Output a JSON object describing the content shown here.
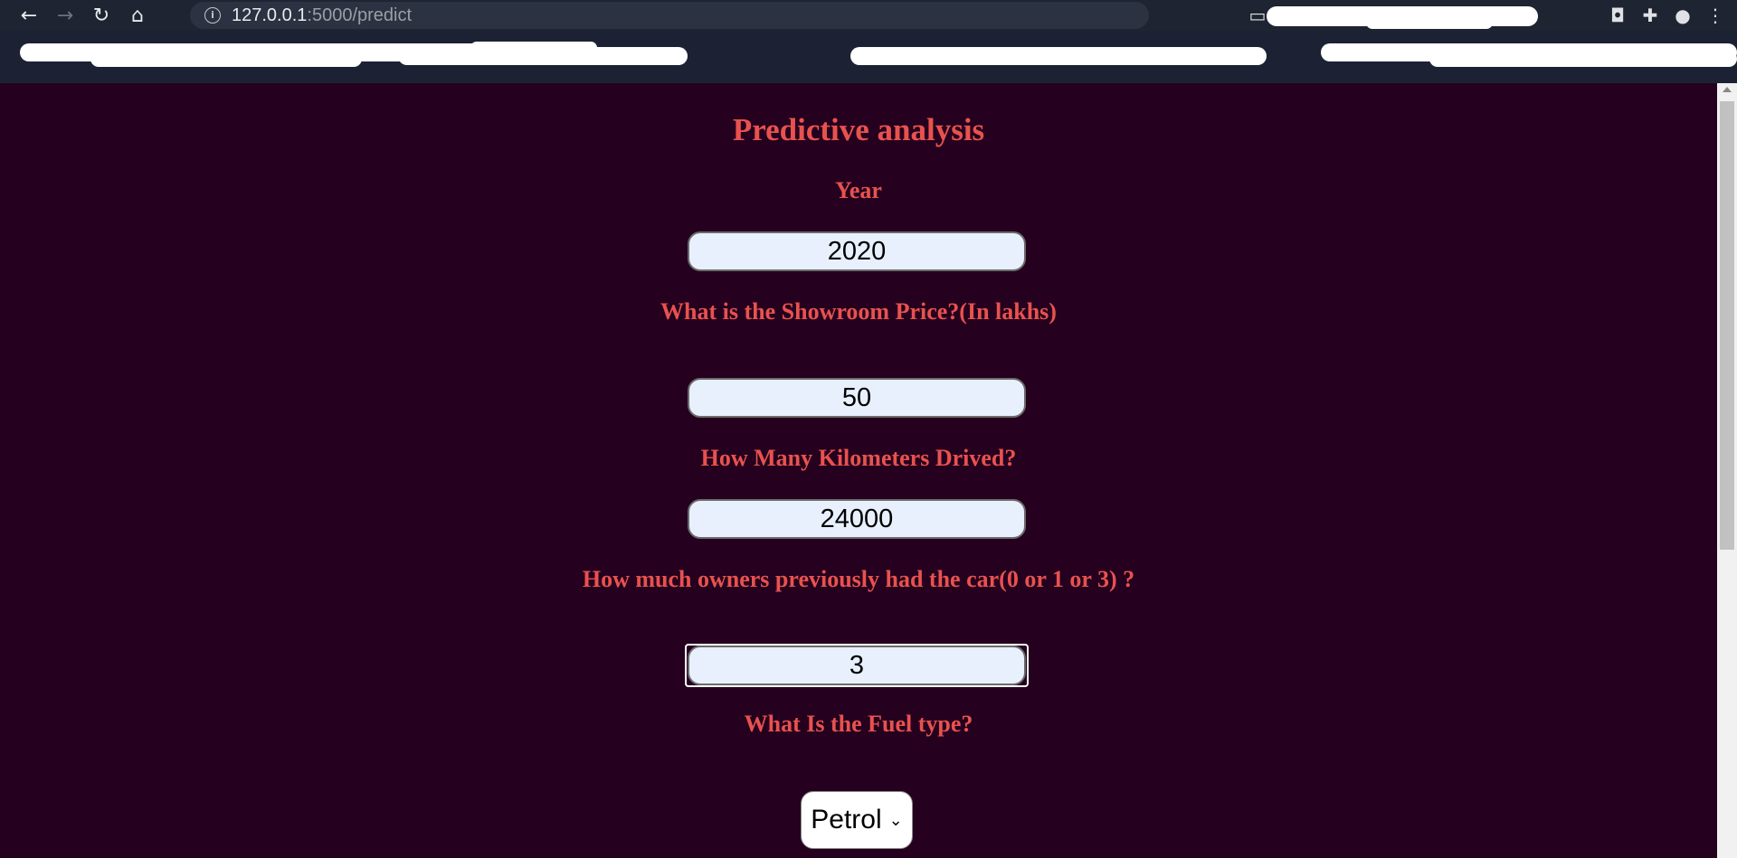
{
  "browser": {
    "url_host": "127.0.0.1",
    "url_path": ":5000/predict",
    "icons": [
      "back-arrow-icon",
      "forward-arrow-icon",
      "reload-icon",
      "home-icon",
      "info-icon",
      "cast-icon",
      "grid-icon",
      "star-icon",
      "extensions-puzzle-icon",
      "profile-avatar-icon",
      "menu-kebab-icon"
    ]
  },
  "page": {
    "title": "Predictive analysis",
    "year_label": "Year",
    "year_value": "2020",
    "price_label": "What is the Showroom Price?(In lakhs)",
    "price_value": "50",
    "km_label": "How Many Kilometers Drived?",
    "km_value": "24000",
    "owners_label": "How much owners previously had the car(0 or 1 or 3) ?",
    "owners_value": "3",
    "fuel_label": "What Is the Fuel type?",
    "fuel_value": "Petrol"
  },
  "colors": {
    "background": "#25001f",
    "heading": "#e8524e",
    "input_fill": "#e8f0fe"
  }
}
